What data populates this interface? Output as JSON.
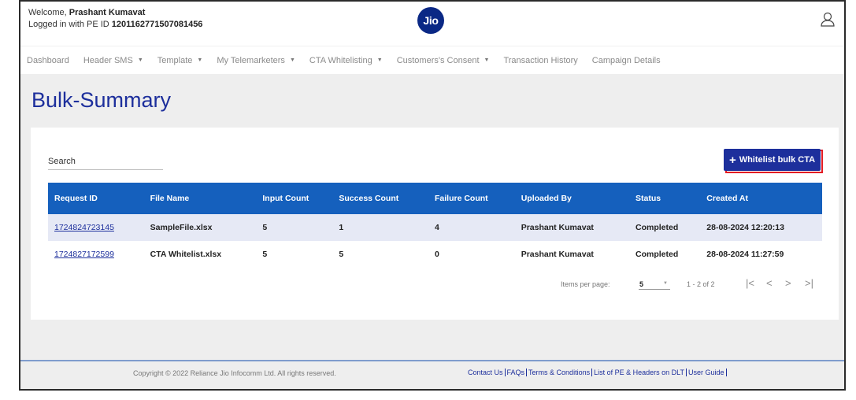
{
  "header": {
    "welcome_prefix": "Welcome, ",
    "user_name": "Prashant Kumavat",
    "login_prefix": "Logged in with PE ID ",
    "pe_id": "1201162771507081456",
    "logo_text": "Jio"
  },
  "nav": [
    {
      "label": "Dashboard",
      "caret": false
    },
    {
      "label": "Header SMS",
      "caret": true
    },
    {
      "label": "Template",
      "caret": true
    },
    {
      "label": "My Telemarketers",
      "caret": true
    },
    {
      "label": "CTA Whitelisting",
      "caret": true
    },
    {
      "label": "Customers's Consent",
      "caret": true
    },
    {
      "label": "Transaction History",
      "caret": false
    },
    {
      "label": "Campaign Details",
      "caret": false
    }
  ],
  "page": {
    "title": "Bulk-Summary",
    "search_placeholder": "Search",
    "whitelist_button": "Whitelist bulk CTA"
  },
  "table": {
    "columns": [
      "Request ID",
      "File Name",
      "Input Count",
      "Success Count",
      "Failure Count",
      "Uploaded By",
      "Status",
      "Created At"
    ],
    "rows": [
      [
        "1724824723145",
        "SampleFile.xlsx",
        "5",
        "1",
        "4",
        "Prashant Kumavat",
        "Completed",
        "28-08-2024 12:20:13"
      ],
      [
        "1724827172599",
        "CTA Whitelist.xlsx",
        "5",
        "5",
        "0",
        "Prashant Kumavat",
        "Completed",
        "28-08-2024 11:27:59"
      ]
    ]
  },
  "pager": {
    "items_label": "Items per page:",
    "per_page": "5",
    "range": "1 - 2 of 2",
    "first": "|<",
    "prev": "<",
    "next": ">",
    "last": ">|"
  },
  "footer": {
    "copyright": "Copyright © 2022 Reliance Jio Infocomm Ltd. All rights reserved.",
    "links": [
      "Contact Us",
      "FAQs",
      "Terms & Conditions",
      "List of PE & Headers on DLT",
      "User Guide"
    ]
  },
  "colors": {
    "brand_blue": "#1d2f9c",
    "table_header": "#1560bd",
    "highlight_red": "#e31b23"
  }
}
